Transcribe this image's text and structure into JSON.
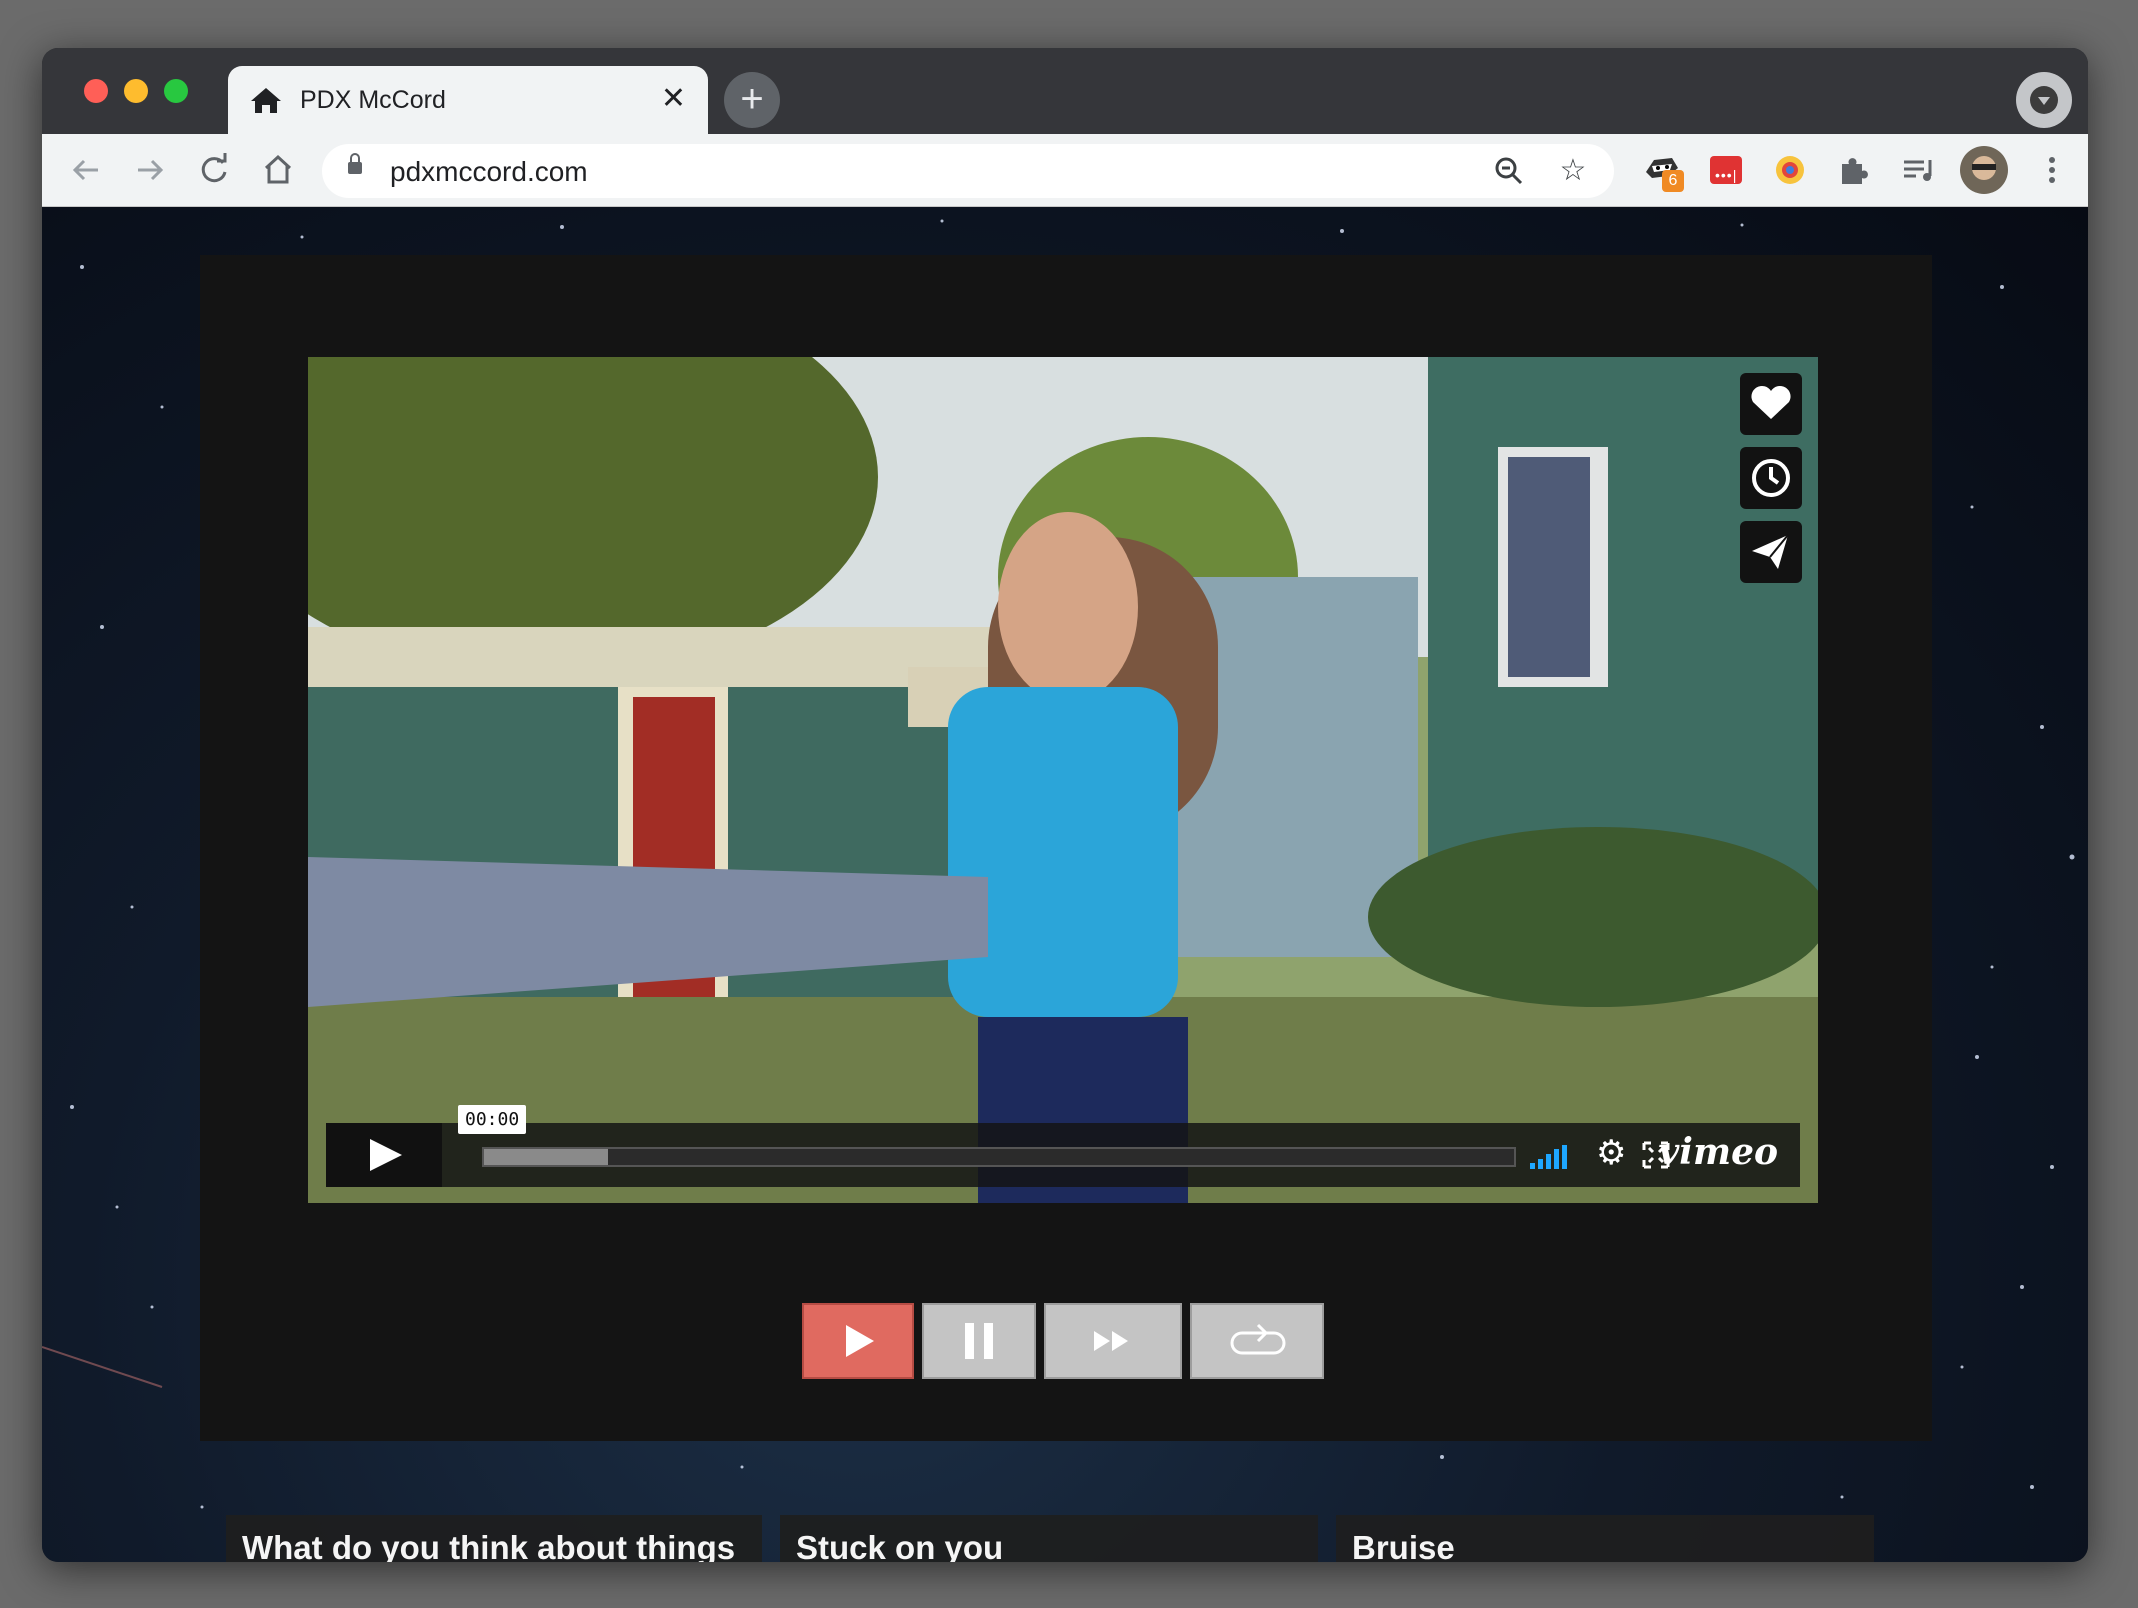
{
  "browser": {
    "tab_title": "PDX McCord",
    "url": "pdxmccord.com",
    "extension_badge": "6"
  },
  "player": {
    "time": "00:00",
    "progress": 0.12,
    "brand": "vimeo"
  },
  "cards": [
    {
      "title": "What do you think about things"
    },
    {
      "title": "Stuck on you"
    },
    {
      "title": "Bruise"
    }
  ],
  "colors": {
    "play_accent": "#e06a60",
    "volume_blue": "#1ea7ff",
    "extension_red": "#e03333",
    "badge_orange": "#f08a24"
  }
}
